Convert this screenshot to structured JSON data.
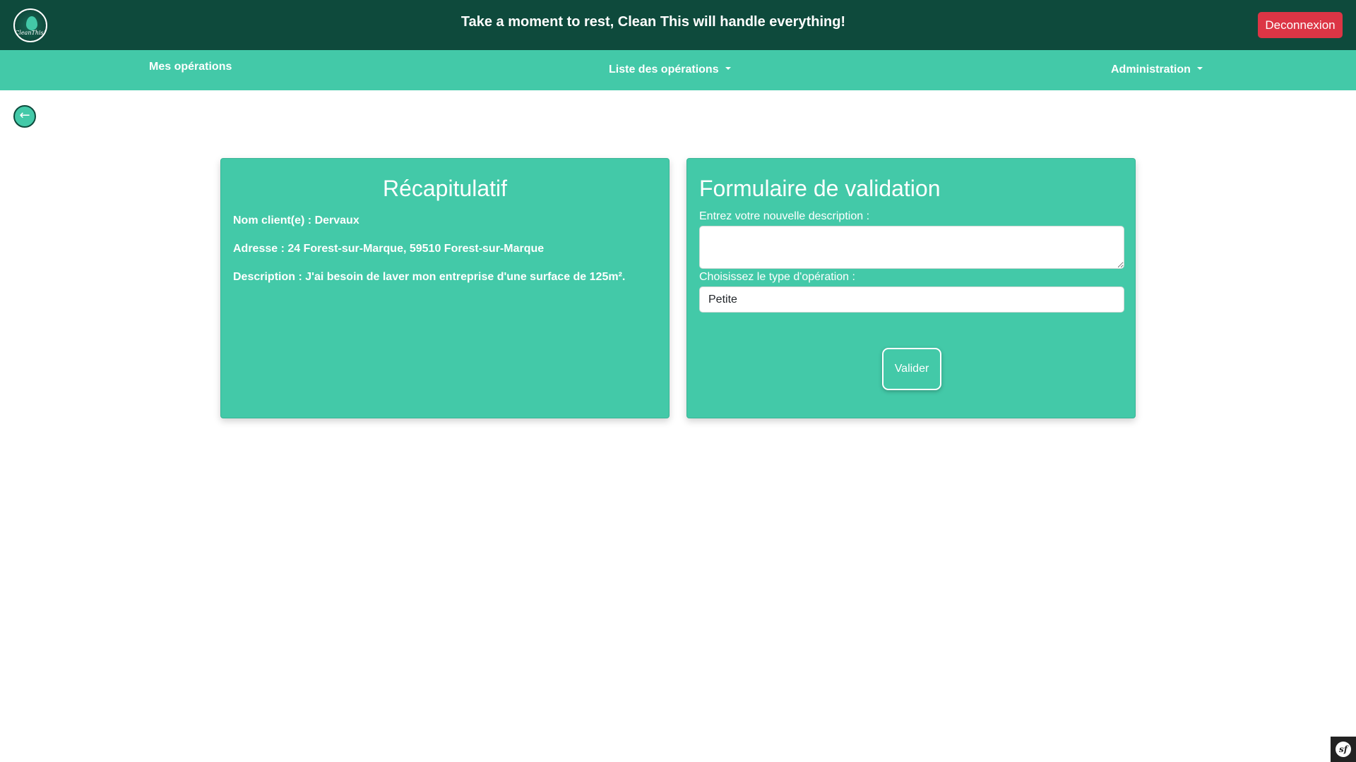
{
  "header": {
    "logo_text": "CleanThis!",
    "tagline": "Take a moment to rest, Clean This will handle everything!",
    "logout_label": "Deconnexion"
  },
  "nav": {
    "my_operations": "Mes opérations",
    "operations_list": "Liste des opérations",
    "administration": "Administration"
  },
  "back_button": {
    "icon": "arrow-left-icon",
    "glyph": "←"
  },
  "summary": {
    "title": "Récapitulatif",
    "client_name": "Nom client(e) : Dervaux",
    "address": "Adresse : 24 Forest-sur-Marque, 59510 Forest-sur-Marque",
    "description": "Description : J'ai besoin de laver mon entreprise d'une surface de 125m²."
  },
  "validation_form": {
    "title": "Formulaire de validation",
    "description_label": "Entrez votre nouvelle description :",
    "description_value": "",
    "type_label": "Choisissez le type d'opération :",
    "type_selected": "Petite",
    "submit_label": "Valider"
  },
  "colors": {
    "header_bg": "#0e4a3c",
    "accent": "#43c9a8",
    "danger": "#dc3545"
  },
  "debug_toolbar": {
    "icon": "symfony-icon",
    "glyph": "sf"
  }
}
